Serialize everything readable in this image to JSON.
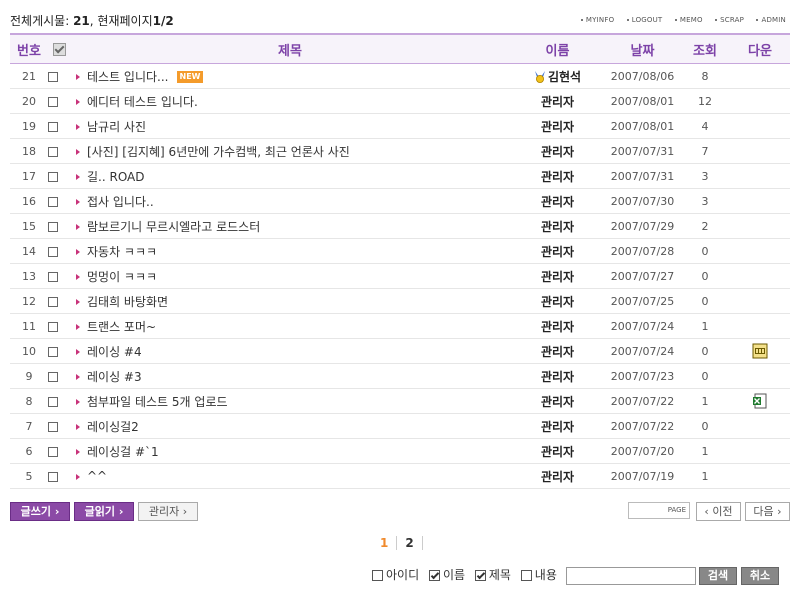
{
  "summary": {
    "label_total": "전체게시물: ",
    "total": "21",
    "sep": ", ",
    "label_page": "현재페이지",
    "page": "1/2"
  },
  "top_menu": [
    "MYINFO",
    "LOGOUT",
    "MEMO",
    "SCRAP",
    "ADMIN"
  ],
  "columns": {
    "num": "번호",
    "title": "제목",
    "name": "이름",
    "date": "날짜",
    "hits": "조회",
    "download": "다운"
  },
  "posts": [
    {
      "num": "21",
      "title": "테스트 입니다...",
      "new": "NEW",
      "name": "김현석",
      "medal": true,
      "date": "2007/08/06",
      "hits": "8"
    },
    {
      "num": "20",
      "title": "에디터 테스트 입니다.",
      "name": "관리자",
      "date": "2007/08/01",
      "hits": "12"
    },
    {
      "num": "19",
      "title": "남규리 사진",
      "name": "관리자",
      "date": "2007/08/01",
      "hits": "4"
    },
    {
      "num": "18",
      "title": "[사진] [김지혜] 6년만에 가수컴백, 최근 언론사 사진",
      "name": "관리자",
      "date": "2007/07/31",
      "hits": "7"
    },
    {
      "num": "17",
      "title": "길.. ROAD",
      "name": "관리자",
      "date": "2007/07/31",
      "hits": "3"
    },
    {
      "num": "16",
      "title": "접사 입니다..",
      "name": "관리자",
      "date": "2007/07/30",
      "hits": "3"
    },
    {
      "num": "15",
      "title": "람보르기니 무르시엘라고 로드스터",
      "name": "관리자",
      "date": "2007/07/29",
      "hits": "2"
    },
    {
      "num": "14",
      "title": "자동차 ㅋㅋㅋ",
      "name": "관리자",
      "date": "2007/07/28",
      "hits": "0"
    },
    {
      "num": "13",
      "title": "멍멍이 ㅋㅋㅋ",
      "name": "관리자",
      "date": "2007/07/27",
      "hits": "0"
    },
    {
      "num": "12",
      "title": "김태희 바탕화면",
      "name": "관리자",
      "date": "2007/07/25",
      "hits": "0"
    },
    {
      "num": "11",
      "title": "트랜스 포머~",
      "name": "관리자",
      "date": "2007/07/24",
      "hits": "1"
    },
    {
      "num": "10",
      "title": "레이싱 #4",
      "name": "관리자",
      "date": "2007/07/24",
      "hits": "0",
      "download": "jpg-file-icon"
    },
    {
      "num": "9",
      "title": "레이싱 #3",
      "name": "관리자",
      "date": "2007/07/23",
      "hits": "0"
    },
    {
      "num": "8",
      "title": "첨부파일 테스트 5개 업로드",
      "name": "관리자",
      "date": "2007/07/22",
      "hits": "1",
      "download": "excel-file-icon"
    },
    {
      "num": "7",
      "title": "레이싱걸2",
      "name": "관리자",
      "date": "2007/07/22",
      "hits": "0"
    },
    {
      "num": "6",
      "title": "레이싱걸 #`1",
      "name": "관리자",
      "date": "2007/07/20",
      "hits": "1"
    },
    {
      "num": "5",
      "title": "^^",
      "name": "관리자",
      "date": "2007/07/19",
      "hits": "1"
    }
  ],
  "buttons": {
    "write": "글쓰기 ›",
    "read": "글읽기 ›",
    "admin": "관리자 ›",
    "page_tag": "PAGE",
    "prev": "‹ 이전",
    "next": "다음 ›"
  },
  "pagination": {
    "pages": [
      "1",
      "2"
    ],
    "current": "1"
  },
  "search": {
    "opt_id": "아이디",
    "opt_name": "이름",
    "opt_title": "제목",
    "opt_content": "내용",
    "search_btn": "검색",
    "cancel_btn": "취소",
    "checked": {
      "id": false,
      "name": true,
      "title": true,
      "content": false
    }
  },
  "colors": {
    "accent": "#8b4aa6",
    "header_text": "#7d42a8",
    "new_badge": "#f49b2b",
    "arrow": "#c8327a",
    "current_page": "#f08a2c"
  }
}
